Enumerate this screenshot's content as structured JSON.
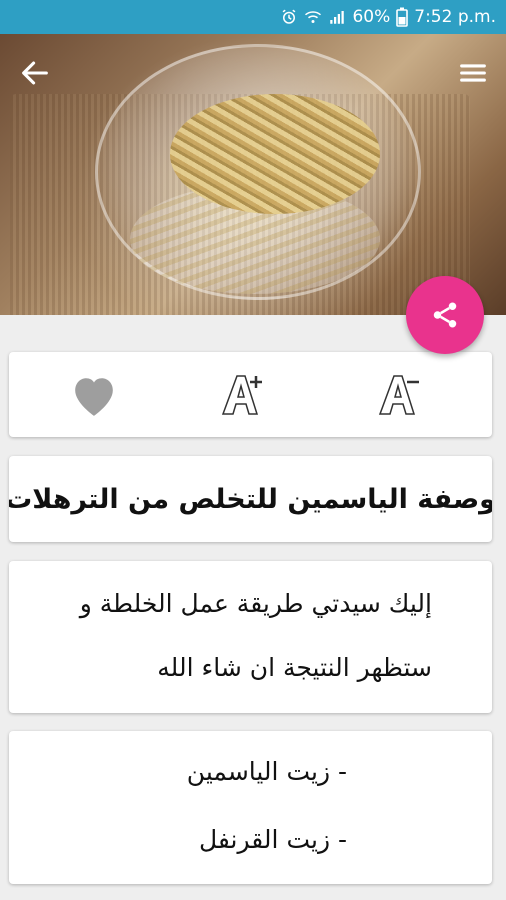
{
  "status_bar": {
    "battery_percent": "60%",
    "time": "7:52 p.m.",
    "icons": [
      "alarm-icon",
      "wifi-icon",
      "signal-icon",
      "battery-icon"
    ]
  },
  "hero": {
    "back_icon": "arrow-left-icon",
    "menu_icon": "hamburger-menu-icon",
    "share_icon": "share-icon"
  },
  "colors": {
    "status_bar": "#2e9fc4",
    "share_fab": "#e9338d",
    "heart": "#9e9e9e"
  },
  "actions": {
    "favorite_icon": "heart-icon",
    "font_increase_icon": "font-increase-icon",
    "font_decrease_icon": "font-decrease-icon"
  },
  "article": {
    "title": "وصفة الياسمين للتخلص من الترهلات",
    "intro_line_1": "إليك سيدتي طريقة عمل الخلطة و",
    "intro_line_2": "ستظهر النتيجة ان شاء الله",
    "ingredients": [
      "- زيت الياسمين",
      "- زيت القرنفل"
    ]
  }
}
